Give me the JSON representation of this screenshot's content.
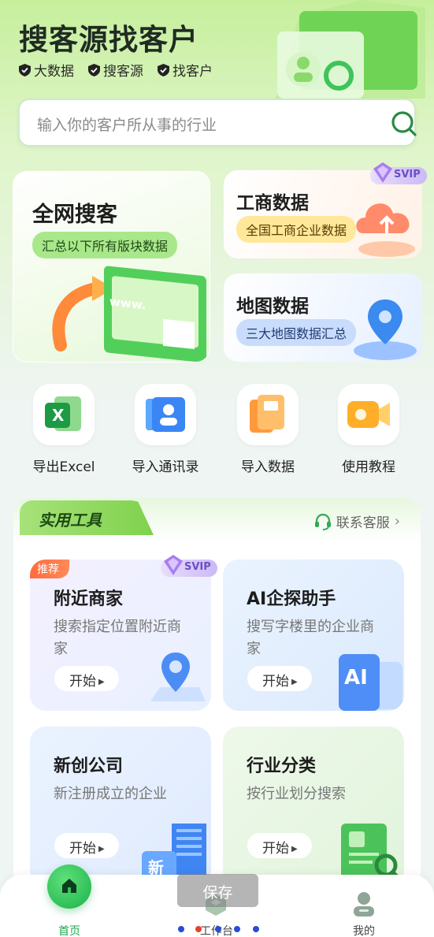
{
  "header": {
    "title": "搜客源找客户",
    "features": [
      "大数据",
      "搜客源",
      "找客户"
    ]
  },
  "search": {
    "placeholder": "输入你的客户所从事的行业"
  },
  "cards": {
    "full_search": {
      "title": "全网搜客",
      "subtitle": "汇总以下所有版块数据",
      "deco_text": "www."
    },
    "business": {
      "title": "工商数据",
      "subtitle": "全国工商企业数据",
      "badge": "SVIP"
    },
    "map": {
      "title": "地图数据",
      "subtitle": "三大地图数据汇总"
    }
  },
  "quick_actions": [
    {
      "label": "导出Excel",
      "icon": "excel-icon",
      "glyph": "X"
    },
    {
      "label": "导入通讯录",
      "icon": "contacts-icon"
    },
    {
      "label": "导入数据",
      "icon": "import-data-icon"
    },
    {
      "label": "使用教程",
      "icon": "tutorial-video-icon"
    }
  ],
  "tools": {
    "section_title": "实用工具",
    "support_label": "联系客服",
    "support_chevron": "›",
    "items": [
      {
        "title": "附近商家",
        "desc": "搜索指定位置附近商家",
        "button": "开始",
        "tag": "推荐",
        "badge": "SVIP"
      },
      {
        "title": "AI企探助手",
        "desc": "搜写字楼里的企业商家",
        "button": "开始",
        "deco_text": "AI"
      },
      {
        "title": "新创公司",
        "desc": "新注册成立的企业",
        "button": "开始",
        "deco_text": "新"
      },
      {
        "title": "行业分类",
        "desc": "按行业划分搜索",
        "button": "开始"
      }
    ]
  },
  "tabbar": {
    "items": [
      "首页",
      "工作台",
      "我的"
    ],
    "active": "首页"
  },
  "toast": {
    "text": "保存"
  },
  "colors": {
    "accent": "#1ab24a",
    "svip": "#6a4fc7",
    "recommend": "#ff6a3d"
  }
}
